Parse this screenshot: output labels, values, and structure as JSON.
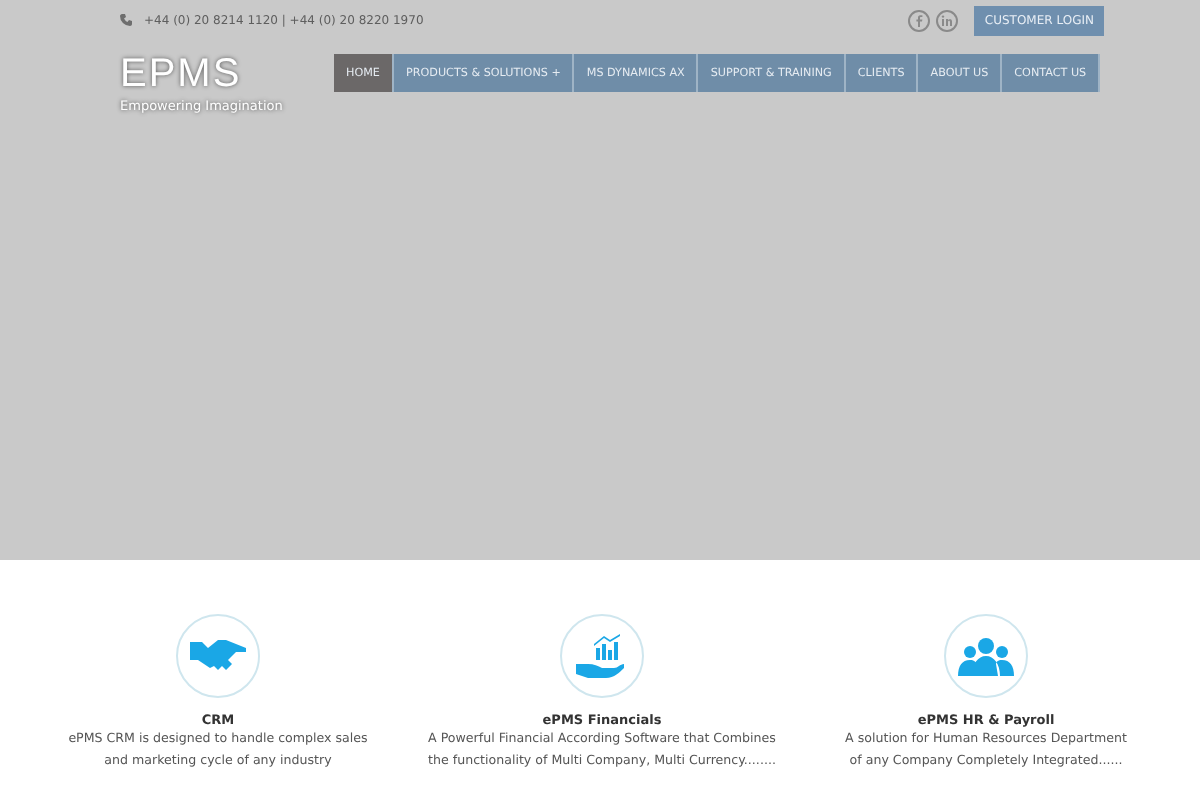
{
  "header": {
    "phone": "+44 (0) 20 8214 1120 | +44 (0) 20 8220 1970",
    "login": "CUSTOMER LOGIN",
    "logo": "EPMS",
    "tagline": "Empowering Imagination"
  },
  "nav": [
    {
      "label": "HOME",
      "selected": true
    },
    {
      "label": "PRODUCTS & SOLUTIONS +",
      "selected": false
    },
    {
      "label": "MS DYNAMICS AX",
      "selected": false
    },
    {
      "label": "SUPPORT & TRAINING",
      "selected": false
    },
    {
      "label": "CLIENTS",
      "selected": false
    },
    {
      "label": "ABOUT US",
      "selected": false
    },
    {
      "label": "CONTACT US",
      "selected": false
    }
  ],
  "features": [
    {
      "kind": "handshake",
      "title": "CRM",
      "lines": [
        "ePMS CRM is designed to handle complex sales",
        "and marketing cycle of any industry"
      ]
    },
    {
      "kind": "chart",
      "title": "ePMS Financials",
      "lines": [
        "A Powerful Financial According Software that Combines",
        "the functionality of Multi Company, Multi Currency........"
      ]
    },
    {
      "kind": "people",
      "title": "ePMS HR & Payroll",
      "lines": [
        "A solution for Human Resources Department",
        "of any Company Completely Integrated......"
      ]
    }
  ]
}
